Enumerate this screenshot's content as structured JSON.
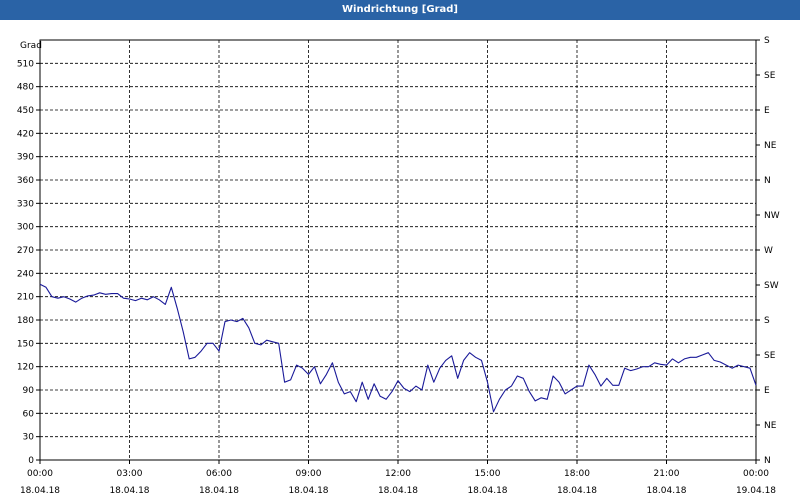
{
  "window": {
    "title": "Windrichtung [Grad]"
  },
  "colors": {
    "line": "#1a1a99",
    "titlebar": "#2a63a6",
    "grid": "#000000"
  },
  "chart_data": {
    "type": "line",
    "title": "Windrichtung [Grad]",
    "ylabel": "Grad",
    "ylim": [
      0,
      540
    ],
    "yticks": [
      0,
      30,
      60,
      90,
      120,
      150,
      180,
      210,
      240,
      270,
      300,
      330,
      360,
      390,
      420,
      450,
      480,
      510
    ],
    "right_axis_labels": [
      "N",
      "NE",
      "E",
      "SE",
      "S",
      "SW",
      "W",
      "NW",
      "N",
      "NE",
      "E",
      "SE",
      "S"
    ],
    "right_axis_values": [
      0,
      45,
      90,
      135,
      180,
      225,
      270,
      315,
      360,
      405,
      450,
      495,
      540
    ],
    "x_tick_times": [
      "00:00",
      "03:00",
      "06:00",
      "09:00",
      "12:00",
      "15:00",
      "18:00",
      "21:00",
      "00:00"
    ],
    "x_tick_dates": [
      "18.04.18",
      "18.04.18",
      "18.04.18",
      "18.04.18",
      "18.04.18",
      "18.04.18",
      "18.04.18",
      "18.04.18",
      "19.04.18"
    ],
    "grid": true,
    "series": [
      {
        "x_hours": [
          0,
          0.2,
          0.4,
          0.6,
          0.8,
          1.0,
          1.2,
          1.4,
          1.6,
          1.8,
          2.0,
          2.2,
          2.4,
          2.6,
          2.8,
          3.0,
          3.2,
          3.4,
          3.6,
          3.8,
          4.0,
          4.2,
          4.4,
          4.6,
          4.8,
          5.0,
          5.2,
          5.4,
          5.6,
          5.8,
          6.0,
          6.2,
          6.4,
          6.6,
          6.8,
          7.0,
          7.2,
          7.4,
          7.6,
          7.8,
          8.0,
          8.2,
          8.4,
          8.6,
          8.8,
          9.0,
          9.2,
          9.4,
          9.6,
          9.8,
          10.0,
          10.2,
          10.4,
          10.6,
          10.8,
          11.0,
          11.2,
          11.4,
          11.6,
          11.8,
          12.0,
          12.2,
          12.4,
          12.6,
          12.8,
          13.0,
          13.2,
          13.4,
          13.6,
          13.8,
          14.0,
          14.2,
          14.4,
          14.6,
          14.8,
          15.0,
          15.2,
          15.4,
          15.6,
          15.8,
          16.0,
          16.2,
          16.4,
          16.6,
          16.8,
          17.0,
          17.2,
          17.4,
          17.6,
          17.8,
          18.0,
          18.2,
          18.4,
          18.6,
          18.8,
          19.0,
          19.2,
          19.4,
          19.6,
          19.8,
          20.0,
          20.2,
          20.4,
          20.6,
          20.8,
          21.0,
          21.2,
          21.4,
          21.6,
          21.8,
          22.0,
          22.2,
          22.4,
          22.6,
          22.8,
          23.0,
          23.2,
          23.4,
          23.6,
          23.8,
          24.0
        ],
        "values": [
          226,
          222,
          210,
          208,
          210,
          207,
          203,
          208,
          211,
          212,
          215,
          213,
          214,
          214,
          208,
          207,
          205,
          208,
          206,
          210,
          206,
          200,
          222,
          195,
          165,
          130,
          132,
          140,
          150,
          150,
          140,
          178,
          180,
          178,
          182,
          170,
          150,
          148,
          154,
          152,
          150,
          100,
          103,
          122,
          118,
          110,
          120,
          98,
          110,
          125,
          100,
          85,
          88,
          75,
          100,
          78,
          98,
          82,
          78,
          88,
          102,
          92,
          88,
          95,
          90,
          122,
          100,
          118,
          128,
          134,
          105,
          128,
          138,
          132,
          128,
          100,
          62,
          78,
          90,
          95,
          108,
          105,
          88,
          76,
          80,
          78,
          108,
          100,
          85,
          90,
          95,
          95,
          122,
          110,
          95,
          105,
          96,
          96,
          118,
          115,
          117,
          120,
          120,
          125,
          123,
          122,
          130,
          125,
          130,
          132,
          132,
          135,
          138,
          128,
          126,
          122,
          118,
          122,
          120,
          118,
          96
        ]
      }
    ]
  }
}
